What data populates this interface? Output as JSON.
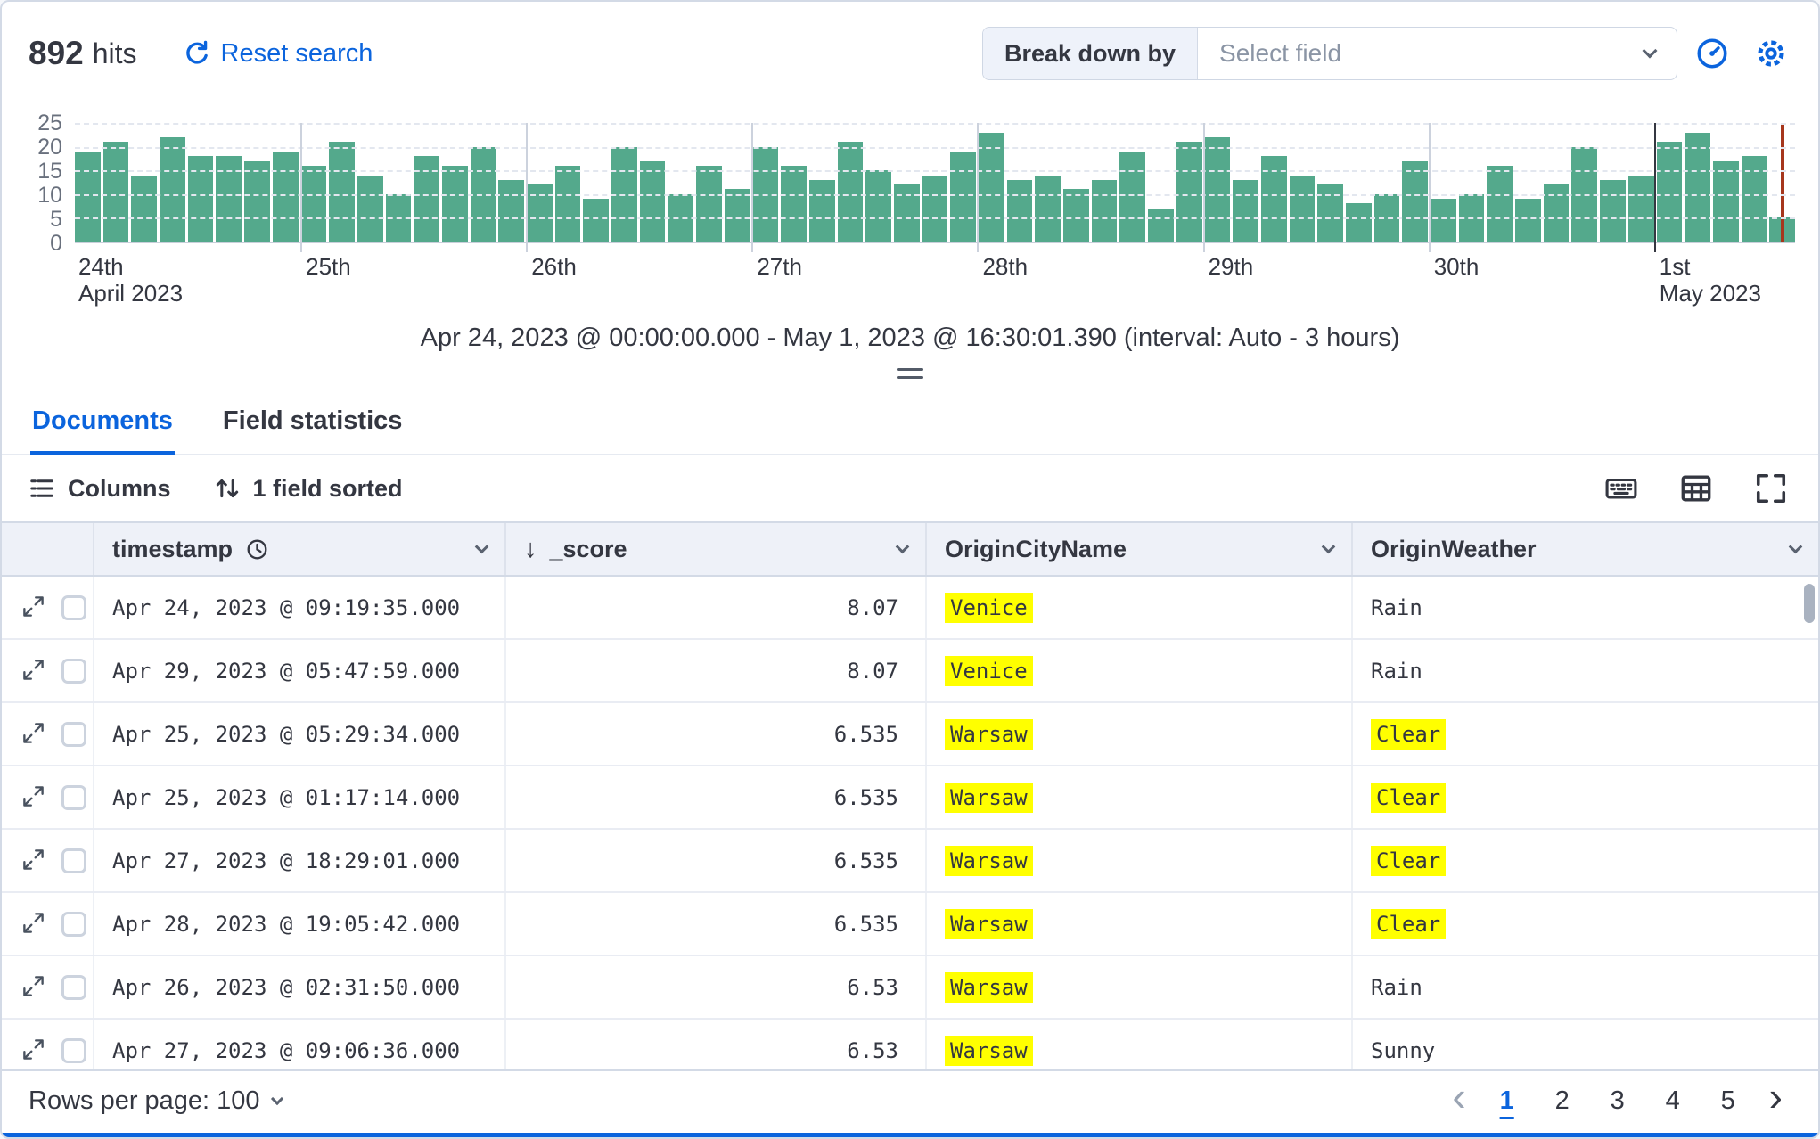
{
  "colors": {
    "accent": "#0b64dd",
    "bar": "#54a98c",
    "highlight": "#ffff00",
    "now_line": "#a6361c"
  },
  "header": {
    "hits_count": "892",
    "hits_label": "hits",
    "reset_label": "Reset search",
    "breakdown_label": "Break down by",
    "breakdown_placeholder": "Select field"
  },
  "chart_data": {
    "type": "bar",
    "title": "",
    "xlabel": "",
    "ylabel": "",
    "ylim": [
      0,
      25
    ],
    "yticks": [
      25,
      20,
      15,
      10,
      5,
      0
    ],
    "grid": true,
    "interval": "Auto - 3 hours",
    "bars_per_day": 8,
    "x_day_labels": [
      {
        "label": "24th",
        "sub": "April 2023"
      },
      {
        "label": "25th"
      },
      {
        "label": "26th"
      },
      {
        "label": "27th"
      },
      {
        "label": "28th"
      },
      {
        "label": "29th"
      },
      {
        "label": "30th"
      },
      {
        "label": "1st",
        "sub": "May 2023"
      }
    ],
    "values": [
      19,
      21,
      14,
      22,
      18,
      18,
      17,
      19,
      16,
      21,
      14,
      10,
      18,
      16,
      20,
      13,
      12,
      16,
      9,
      20,
      17,
      10,
      16,
      11,
      20,
      16,
      13,
      21,
      15,
      12,
      14,
      19,
      23,
      13,
      14,
      11,
      13,
      19,
      7,
      21,
      22,
      13,
      18,
      14,
      12,
      8,
      10,
      17,
      9,
      10,
      16,
      9,
      12,
      20,
      13,
      14,
      21,
      23,
      17,
      18,
      5
    ],
    "caption": "Apr 24, 2023 @ 00:00:00.000 - May 1, 2023 @ 16:30:01.390 (interval: Auto - 3 hours)"
  },
  "tabs": {
    "documents": "Documents",
    "field_statistics": "Field statistics"
  },
  "toolbar": {
    "columns": "Columns",
    "sorted": "1 field sorted"
  },
  "table": {
    "columns": {
      "timestamp": "timestamp",
      "score": "_score",
      "city": "OriginCityName",
      "weather": "OriginWeather"
    },
    "rows": [
      {
        "timestamp": "Apr 24, 2023 @ 09:19:35.000",
        "score": "8.07",
        "city": "Venice",
        "city_hl": true,
        "weather": "Rain",
        "weather_hl": false
      },
      {
        "timestamp": "Apr 29, 2023 @ 05:47:59.000",
        "score": "8.07",
        "city": "Venice",
        "city_hl": true,
        "weather": "Rain",
        "weather_hl": false
      },
      {
        "timestamp": "Apr 25, 2023 @ 05:29:34.000",
        "score": "6.535",
        "city": "Warsaw",
        "city_hl": true,
        "weather": "Clear",
        "weather_hl": true
      },
      {
        "timestamp": "Apr 25, 2023 @ 01:17:14.000",
        "score": "6.535",
        "city": "Warsaw",
        "city_hl": true,
        "weather": "Clear",
        "weather_hl": true
      },
      {
        "timestamp": "Apr 27, 2023 @ 18:29:01.000",
        "score": "6.535",
        "city": "Warsaw",
        "city_hl": true,
        "weather": "Clear",
        "weather_hl": true
      },
      {
        "timestamp": "Apr 28, 2023 @ 19:05:42.000",
        "score": "6.535",
        "city": "Warsaw",
        "city_hl": true,
        "weather": "Clear",
        "weather_hl": true
      },
      {
        "timestamp": "Apr 26, 2023 @ 02:31:50.000",
        "score": "6.53",
        "city": "Warsaw",
        "city_hl": true,
        "weather": "Rain",
        "weather_hl": false
      },
      {
        "timestamp": "Apr 27, 2023 @ 09:06:36.000",
        "score": "6.53",
        "city": "Warsaw",
        "city_hl": true,
        "weather": "Sunny",
        "weather_hl": false
      }
    ]
  },
  "footer": {
    "rows_per_page": "Rows per page: 100",
    "pages": [
      "1",
      "2",
      "3",
      "4",
      "5"
    ],
    "active_page": "1"
  },
  "icons": {
    "sort_desc": "↓",
    "prev": "‹",
    "next": "›"
  }
}
